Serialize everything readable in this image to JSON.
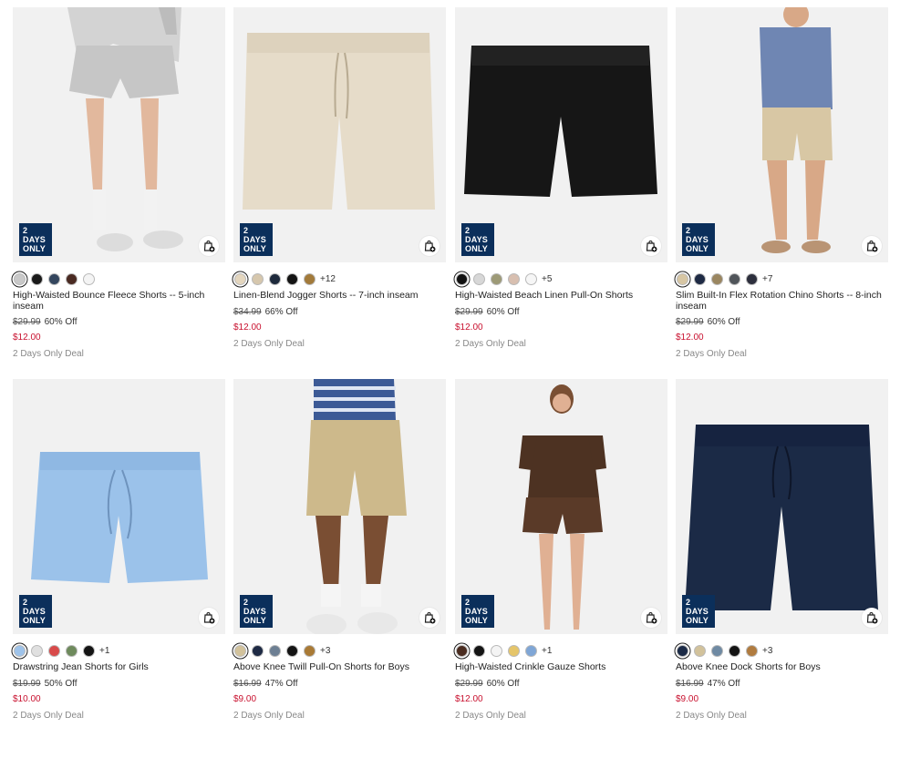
{
  "badge": {
    "line1": "2 DAYS",
    "line2": "ONLY"
  },
  "products": [
    {
      "name": "High-Waisted Bounce Fleece Shorts -- 5-inch inseam",
      "was": "$29.99",
      "discount": "60% Off",
      "now": "$12.00",
      "deal": "2 Days Only Deal",
      "swatches": [
        "#c9c9c9",
        "#1a1a1a",
        "#34465e",
        "#4a2a22",
        "#f4f4f4"
      ],
      "more": "",
      "image": "gray fleece shorts on model"
    },
    {
      "name": "Linen-Blend Jogger Shorts -- 7-inch inseam",
      "was": "$34.99",
      "discount": "66% Off",
      "now": "$12.00",
      "deal": "2 Days Only Deal",
      "swatches": [
        "#e4d6be",
        "#d6c7ad",
        "#1e2a3c",
        "#141414",
        "#a27a3a"
      ],
      "more": "+12",
      "image": "beige linen jogger shorts"
    },
    {
      "name": "High-Waisted Beach Linen Pull-On Shorts",
      "was": "$29.99",
      "discount": "60% Off",
      "now": "$12.00",
      "deal": "2 Days Only Deal",
      "swatches": [
        "#111111",
        "#d7d7d7",
        "#9d9a77",
        "#d8bfb0",
        "#f6f6f6"
      ],
      "more": "+5",
      "image": "black linen pull-on shorts"
    },
    {
      "name": "Slim Built-In Flex Rotation Chino Shorts -- 8-inch inseam",
      "was": "$29.99",
      "discount": "60% Off",
      "now": "$12.00",
      "deal": "2 Days Only Deal",
      "swatches": [
        "#d7c6a3",
        "#1e2a44",
        "#9a8660",
        "#50555a",
        "#2d2f3d"
      ],
      "more": "+7",
      "image": "khaki chino shorts on model"
    },
    {
      "name": "Drawstring Jean Shorts for Girls",
      "was": "$19.99",
      "discount": "50% Off",
      "now": "$10.00",
      "deal": "2 Days Only Deal",
      "swatches": [
        "#9ec3ea",
        "#e0e0e0",
        "#d84a4a",
        "#6e8a5c",
        "#141414"
      ],
      "more": "+1",
      "image": "light blue chambray shorts"
    },
    {
      "name": "Above Knee Twill Pull-On Shorts for Boys",
      "was": "$16.99",
      "discount": "47% Off",
      "now": "$9.00",
      "deal": "2 Days Only Deal",
      "swatches": [
        "#d2c29b",
        "#1e2a44",
        "#6d7f93",
        "#141414",
        "#a97a35"
      ],
      "more": "+3",
      "image": "khaki twill shorts on model"
    },
    {
      "name": "High-Waisted Crinkle Gauze Shorts",
      "was": "$29.99",
      "discount": "60% Off",
      "now": "$12.00",
      "deal": "2 Days Only Deal",
      "swatches": [
        "#4a2c20",
        "#141414",
        "#f4f4f4",
        "#e5c56a",
        "#7fa6d6"
      ],
      "more": "+1",
      "image": "brown gauze set on model"
    },
    {
      "name": "Above Knee Dock Shorts for Boys",
      "was": "$16.99",
      "discount": "47% Off",
      "now": "$9.00",
      "deal": "2 Days Only Deal",
      "swatches": [
        "#1b2a46",
        "#d2c29b",
        "#6f8aa3",
        "#141414",
        "#b07b3f"
      ],
      "more": "+3",
      "image": "navy dock shorts"
    }
  ]
}
